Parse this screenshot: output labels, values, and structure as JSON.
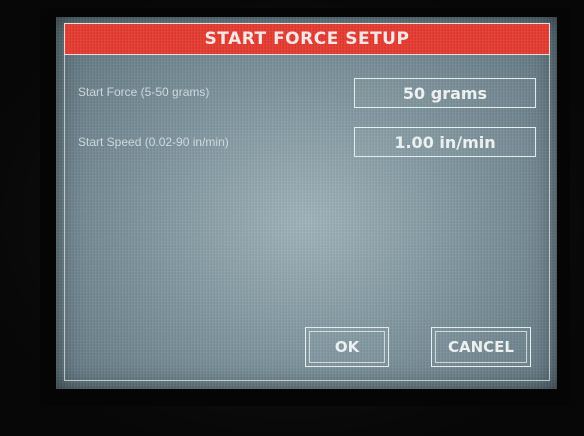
{
  "dialog": {
    "title": "START FORCE SETUP"
  },
  "fields": [
    {
      "label": "Start Force (5-50 grams)",
      "value": "50 grams"
    },
    {
      "label": "Start Speed (0.02-90 in/min)",
      "value": "1.00 in/min"
    }
  ],
  "buttons": {
    "ok_label": "OK",
    "cancel_label": "CANCEL"
  },
  "colors": {
    "title_bar": "#e8392e",
    "screen": "#8fa3ab",
    "text": "#f4f8f8"
  }
}
